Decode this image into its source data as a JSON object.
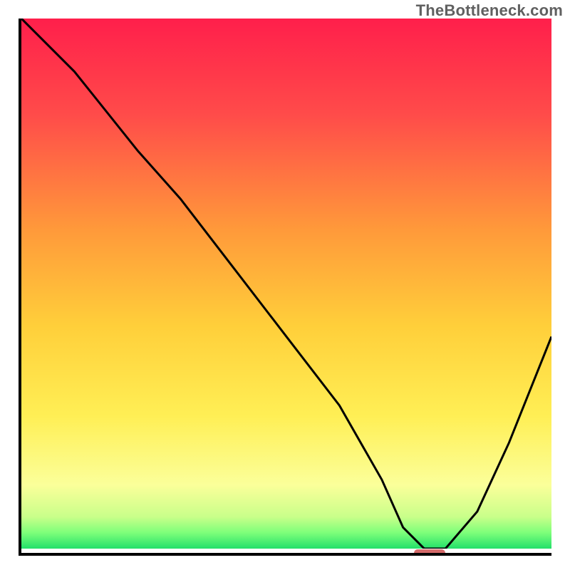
{
  "watermark": "TheBottleneck.com",
  "chart_data": {
    "type": "line",
    "title": "",
    "xlabel": "",
    "ylabel": "",
    "xlim": [
      0,
      100
    ],
    "ylim": [
      0,
      100
    ],
    "grid": false,
    "legend": false,
    "gradient_stops": [
      {
        "pct": 0,
        "color": "#ff1f4b"
      },
      {
        "pct": 18,
        "color": "#ff4b4a"
      },
      {
        "pct": 40,
        "color": "#ff9a3a"
      },
      {
        "pct": 58,
        "color": "#ffcf3a"
      },
      {
        "pct": 75,
        "color": "#ffef55"
      },
      {
        "pct": 88,
        "color": "#fbff9a"
      },
      {
        "pct": 94,
        "color": "#c9ff8a"
      },
      {
        "pct": 97,
        "color": "#7dff7a"
      },
      {
        "pct": 100,
        "color": "#23e06a"
      }
    ],
    "series": [
      {
        "name": "bottleneck-curve",
        "x": [
          0,
          10,
          22,
          30,
          40,
          50,
          60,
          68,
          72,
          76,
          80,
          86,
          92,
          100
        ],
        "y": [
          100,
          90,
          75,
          66,
          53,
          40,
          27,
          13,
          4,
          0,
          0,
          7,
          20,
          40
        ]
      }
    ],
    "marker": {
      "x_start": 74,
      "x_end": 80,
      "y": 0,
      "color": "#d46a6a"
    },
    "curve_stroke": "#000000",
    "curve_width": 3
  }
}
